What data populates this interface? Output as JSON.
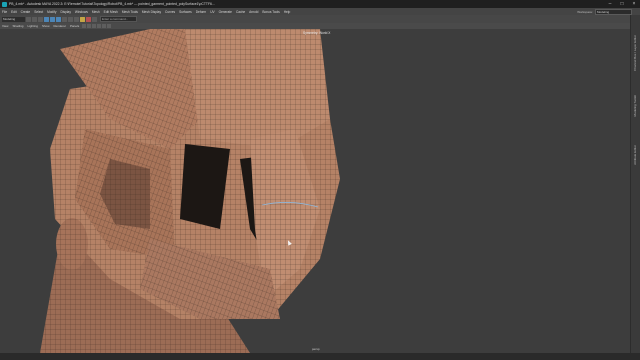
{
  "window": {
    "title": "PB_4.mb* - Autodesk MAYA 2022.3: E:\\Remote\\Tutorial\\Topology\\Robot\\PB_4.mb* --- pointed_garment_pointed_polySurface1\\pCTTF6...",
    "minimize_icon": "minimize-icon",
    "maximize_icon": "maximize-icon",
    "close_icon": "close-icon"
  },
  "menubar": {
    "items": [
      "File",
      "Edit",
      "Create",
      "Select",
      "Modify",
      "Display",
      "Windows",
      "Mesh",
      "Edit Mesh",
      "Mesh Tools",
      "Mesh Display",
      "Curves",
      "Surfaces",
      "Deform",
      "UV",
      "Generate",
      "Cache",
      "Arnold",
      "Bonus Tools",
      "Help"
    ],
    "workspace_label": "Workspace:",
    "workspace_value": "Modeling"
  },
  "statusline": {
    "mode": "Modeling",
    "field_placeholder": "Enter a command..."
  },
  "panel": {
    "menus": [
      "View",
      "Shading",
      "Lighting",
      "Show",
      "Renderer",
      "Panels"
    ]
  },
  "viewport": {
    "symmetry_label": "Symmetry: World X",
    "camera_label": "persp",
    "background_color": "#3d3d3d",
    "mesh_color": "#b58266",
    "wire_color": "#3a2a22"
  },
  "channelbar": {
    "tabs": [
      "Channel Box / Layer Editor",
      "Modeling Toolkit",
      "Attribute Editor"
    ]
  }
}
